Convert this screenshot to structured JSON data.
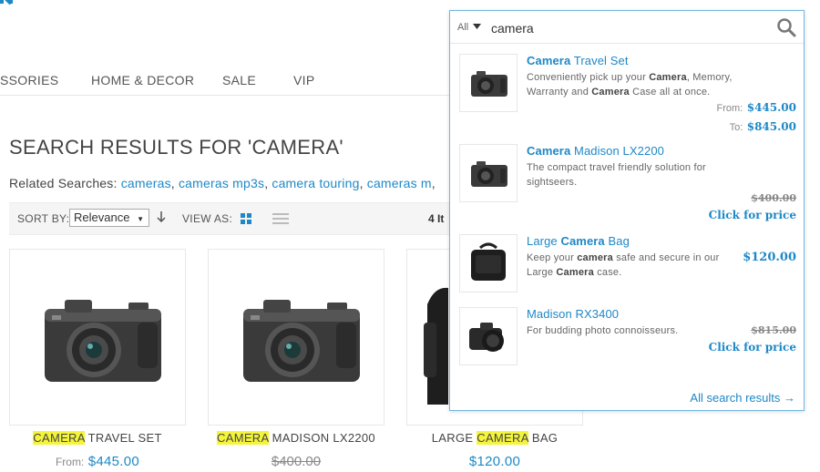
{
  "nav": {
    "items": [
      "SSORIES",
      "HOME & DECOR",
      "SALE",
      "VIP"
    ]
  },
  "page": {
    "title": "SEARCH RESULTS FOR 'CAMERA'"
  },
  "related": {
    "label": "Related Searches:",
    "links": [
      "cameras",
      "cameras mp3s",
      "camera touring",
      "cameras m"
    ],
    "separator": ","
  },
  "toolbar": {
    "sort_label": "SORT BY:",
    "sort_value": "Relevance",
    "view_label": "VIEW AS:",
    "items_count": "4 It",
    "active_view": "grid"
  },
  "products": [
    {
      "name_hl": "CAMERA",
      "name_rest": " TRAVEL SET",
      "from_label": "From:",
      "price": "$445.00",
      "old_price": ""
    },
    {
      "name_hl": "CAMERA",
      "name_rest": " MADISON LX2200",
      "from_label": "",
      "price": "",
      "old_price": "$400.00"
    },
    {
      "name_pre": "LARGE ",
      "name_hl": "CAMERA",
      "name_rest": " BAG",
      "from_label": "",
      "price": "$120.00",
      "old_price": ""
    }
  ],
  "search": {
    "scope": "All",
    "query": "camera",
    "all_results_label": "All search results →",
    "results": [
      {
        "title_bold": "Camera",
        "title_rest": " Travel Set",
        "desc_parts": [
          "Conveniently pick up your ",
          "Camera",
          ", Memory, Warranty and ",
          "Camera",
          " Case all at once."
        ],
        "from_label": "From:",
        "from_price": "$445.00",
        "to_label": "To:",
        "to_price": "$845.00"
      },
      {
        "title_bold": "Camera",
        "title_rest": " Madison LX2200",
        "desc": "The compact travel friendly solution for sightseers.",
        "old_price": "$400.00",
        "cta": "Click for price"
      },
      {
        "title_pre": "Large ",
        "title_bold": "Camera",
        "title_rest": " Bag",
        "desc_parts": [
          "Keep your ",
          "camera",
          " safe and secure in our Large ",
          "Camera",
          " case."
        ],
        "price": "$120.00"
      },
      {
        "title_full": "Madison RX3400",
        "desc": "For budding photo connoisseurs.",
        "old_price": "$815.00",
        "cta": "Click for price"
      }
    ]
  },
  "colors": {
    "accent": "#1e88c7",
    "highlight": "#f4f43a",
    "panel_border": "#6fb7e0"
  }
}
